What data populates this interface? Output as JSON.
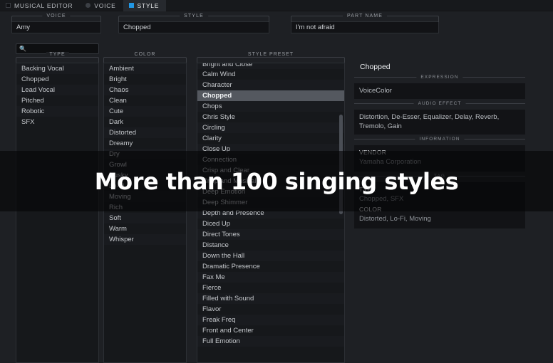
{
  "tabs": [
    {
      "label": "MUSICAL EDITOR",
      "icon": "square-icon",
      "active": false
    },
    {
      "label": "VOICE",
      "icon": "circle-icon",
      "active": false
    },
    {
      "label": "STYLE",
      "icon": "square-filled-icon",
      "active": true
    }
  ],
  "fields": [
    {
      "legend": "VOICE",
      "value": "Amy"
    },
    {
      "legend": "STYLE",
      "value": "Chopped"
    },
    {
      "legend": "PART NAME",
      "value": "I'm not afraid"
    }
  ],
  "search": {
    "value": "",
    "placeholder": "",
    "icon": "search-icon"
  },
  "type_list": {
    "caption": "TYPE",
    "sort_icon": "caret-up-icon",
    "items": [
      "Backing Vocal",
      "Chopped",
      "Lead Vocal",
      "Pitched",
      "Robotic",
      "SFX"
    ]
  },
  "color_list": {
    "caption": "COLOR",
    "sort_icon": "caret-up-icon",
    "items": [
      "Ambient",
      "Bright",
      "Chaos",
      "Clean",
      "Cute",
      "Dark",
      "Distorted",
      "Dreamy",
      "Dry",
      "Growl",
      "Husky",
      "Lo-Fi",
      "Moving",
      "Rich",
      "Soft",
      "Warm",
      "Whisper"
    ]
  },
  "style_preset": {
    "caption": "STYLE PRESET",
    "sort_icon": "caret-up-icon",
    "selected": "Chopped",
    "items": [
      "Bright and Close",
      "Calm Wind",
      "Character",
      "Chopped",
      "Chops",
      "Chris Style",
      "Circling",
      "Clarity",
      "Close Up",
      "Connection",
      "Crisp and Clear",
      "Crisp and Musical",
      "Deep Emotion",
      "Deep Shimmer",
      "Depth and Presence",
      "Diced Up",
      "Direct Tones",
      "Distance",
      "Down the Hall",
      "Dramatic Presence",
      "Fax Me",
      "Fierce",
      "Filled with Sound",
      "Flavor",
      "Freak Freq",
      "Front and Center",
      "Full Emotion"
    ]
  },
  "detail": {
    "title": "Chopped",
    "sections": [
      {
        "heading": "EXPRESSION",
        "text": "VoiceColor"
      },
      {
        "heading": "AUDIO EFFECT",
        "text": "Distortion, De-Esser, Equalizer, Delay, Reverb, Tremolo, Gain"
      }
    ],
    "information": {
      "heading": "INFORMATION",
      "vendor_key": "VENDOR",
      "vendor_value": "Yamaha Corporation"
    },
    "tag": {
      "heading": "TAG",
      "type_key": "TYPE",
      "type_value": "Chopped, SFX",
      "color_key": "COLOR",
      "color_value": "Distorted, Lo-Fi, Moving"
    }
  },
  "overlay": {
    "text": "More than 100 singing styles"
  }
}
